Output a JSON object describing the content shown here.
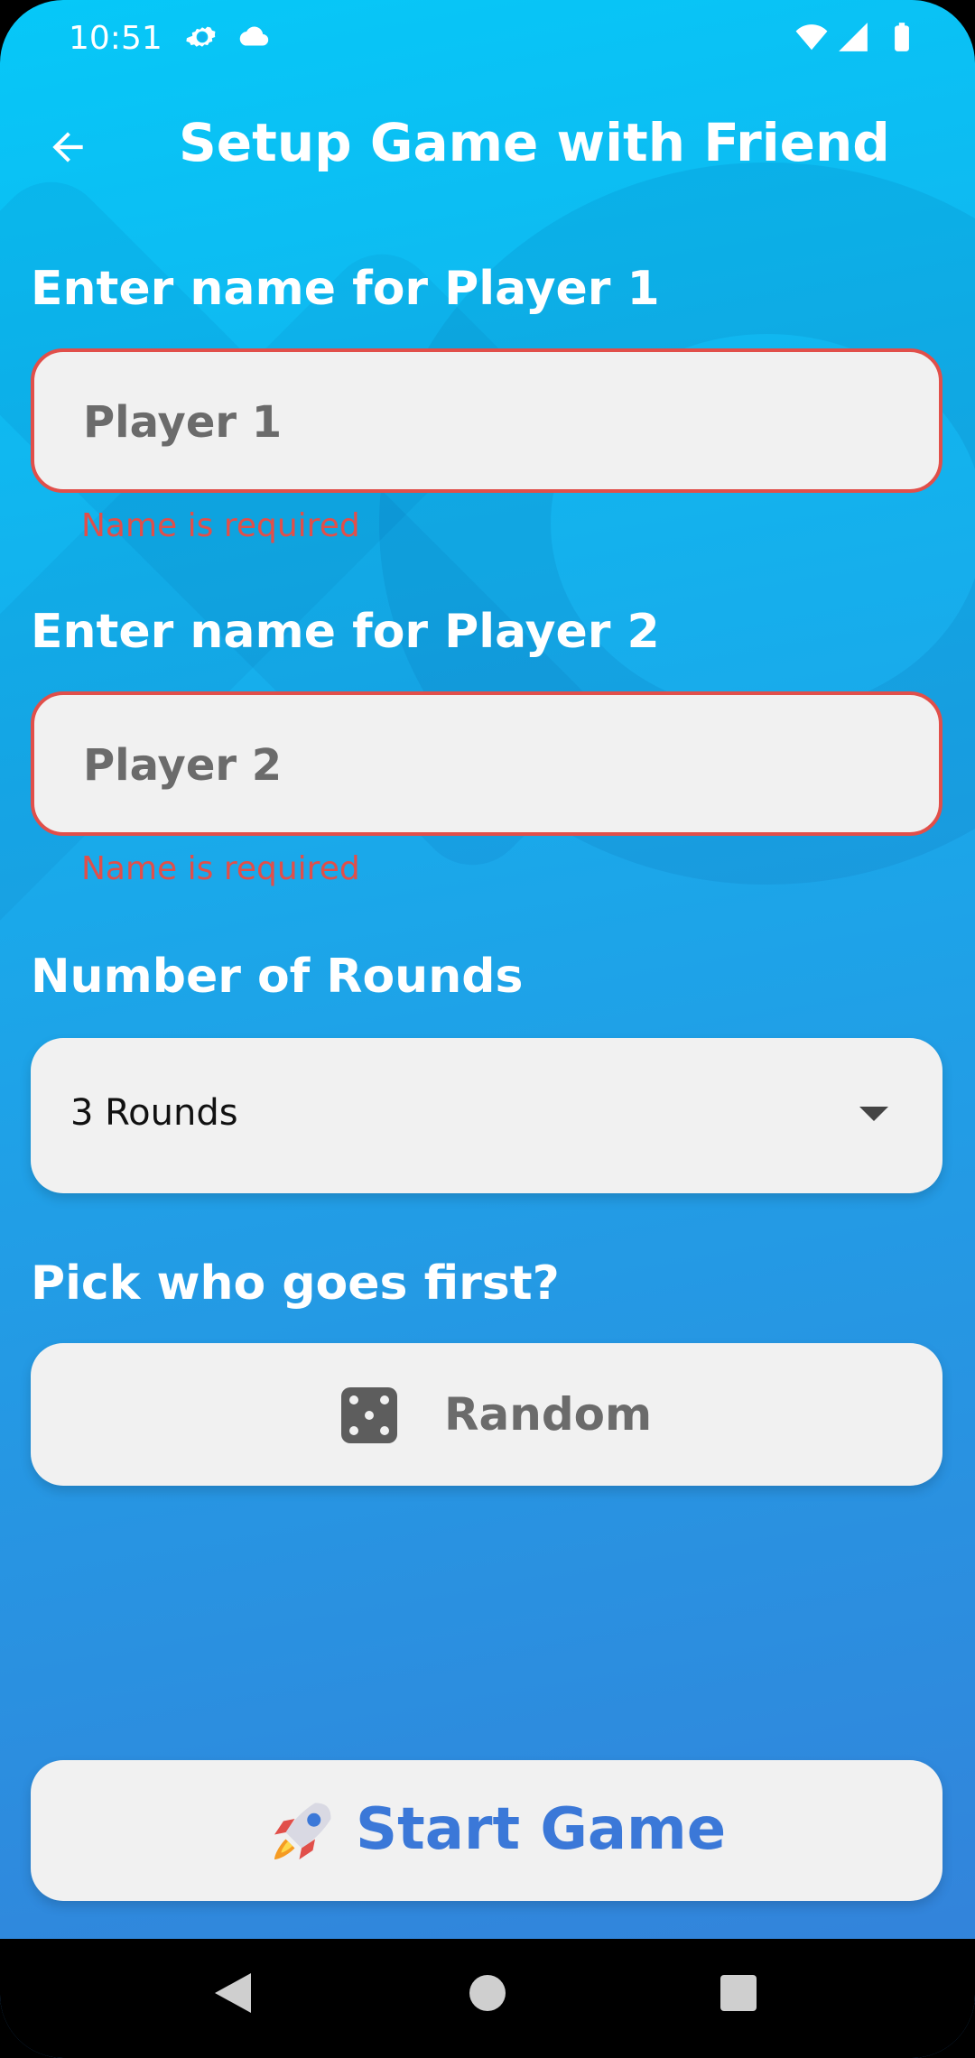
{
  "status": {
    "time": "10:51"
  },
  "appbar": {
    "title": "Setup Game with Friend"
  },
  "player1": {
    "label": "Enter name for Player 1",
    "placeholder": "Player 1",
    "error": "Name is required"
  },
  "player2": {
    "label": "Enter name for Player 2",
    "placeholder": "Player 2",
    "error": "Name is required"
  },
  "rounds": {
    "label": "Number of Rounds",
    "value": "3 Rounds"
  },
  "first": {
    "label": "Pick who goes first?",
    "button": "Random"
  },
  "start": {
    "label": "Start Game"
  },
  "icons": {
    "status": [
      "gear-icon",
      "cloud-icon",
      "wifi-icon",
      "signal-icon",
      "battery-icon"
    ],
    "back": "arrow-left-icon",
    "dice": "dice-icon",
    "rocket": "rocket-icon"
  },
  "colors": {
    "background_top": "#06c8f8",
    "background_bottom": "#3580d9",
    "error": "#e14f4a",
    "accent": "#3b78d8",
    "field": "#f1f1f1"
  }
}
